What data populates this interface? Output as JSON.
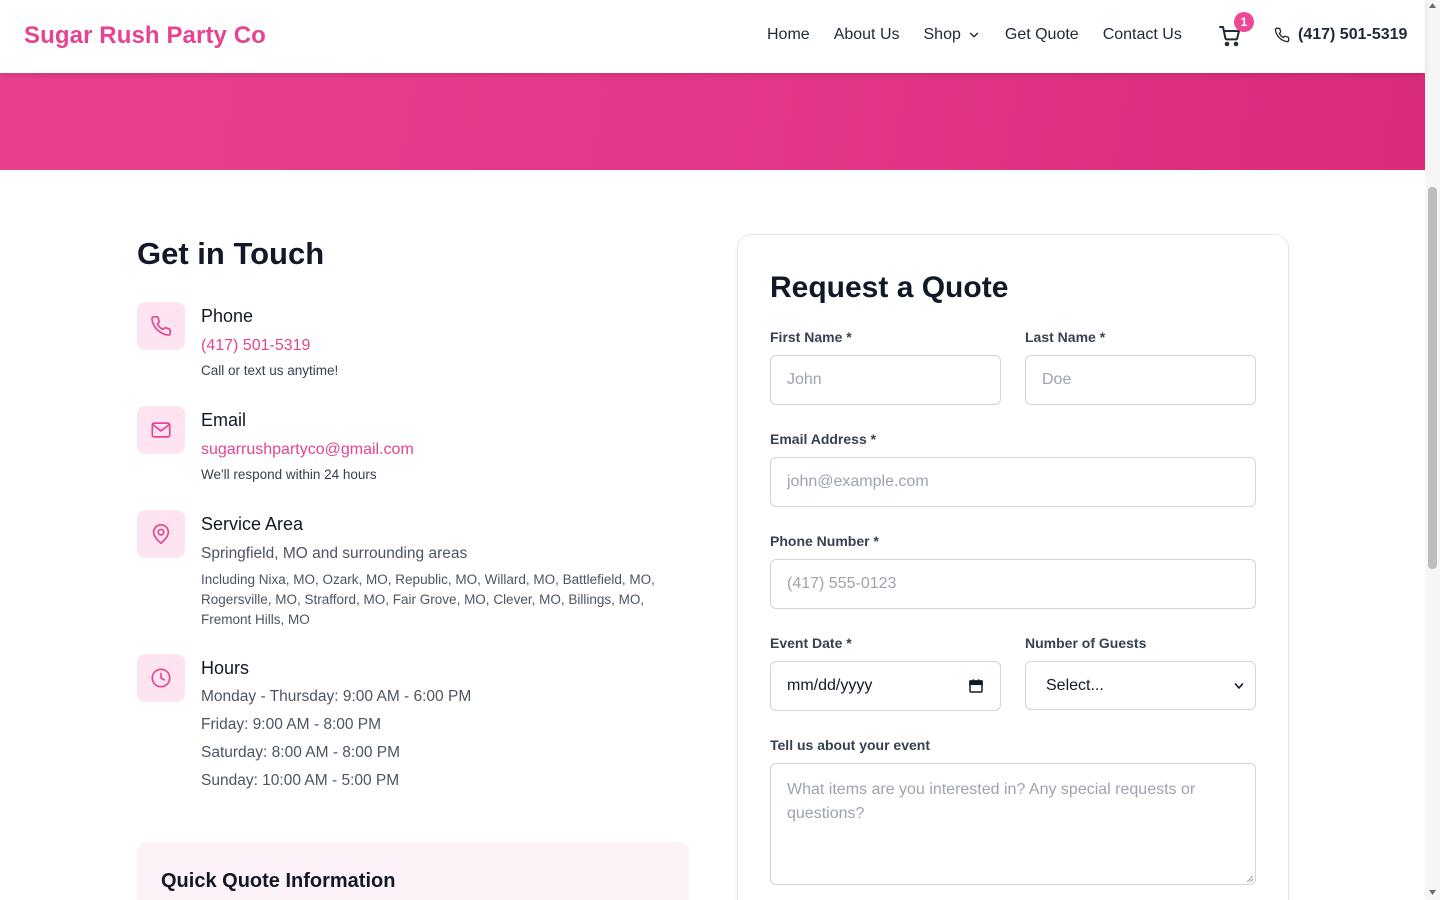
{
  "header": {
    "brand": "Sugar Rush Party Co",
    "nav": [
      "Home",
      "About Us",
      "Shop",
      "Get Quote",
      "Contact Us"
    ],
    "cart_count": "1",
    "phone": "(417) 501-5319"
  },
  "contact": {
    "title": "Get in Touch",
    "phone": {
      "title": "Phone",
      "value": "(417) 501-5319",
      "sub": "Call or text us anytime!"
    },
    "email": {
      "title": "Email",
      "value": "sugarrushpartyco@gmail.com",
      "sub": "We'll respond within 24 hours"
    },
    "area": {
      "title": "Service Area",
      "value": "Springfield, MO and surrounding areas",
      "detail": "Including Nixa, MO, Ozark, MO, Republic, MO, Willard, MO, Battlefield, MO, Rogersville, MO, Strafford, MO, Fair Grove, MO, Clever, MO, Billings, MO, Fremont Hills, MO"
    },
    "hours": {
      "title": "Hours",
      "lines": [
        "Monday - Thursday: 9:00 AM - 6:00 PM",
        "Friday: 9:00 AM - 8:00 PM",
        "Saturday: 8:00 AM - 8:00 PM",
        "Sunday: 10:00 AM - 5:00 PM"
      ]
    },
    "quick_quote_title": "Quick Quote Information"
  },
  "form": {
    "title": "Request a Quote",
    "first_name": {
      "label": "First Name *",
      "placeholder": "John"
    },
    "last_name": {
      "label": "Last Name *",
      "placeholder": "Doe"
    },
    "email": {
      "label": "Email Address *",
      "placeholder": "john@example.com"
    },
    "phone": {
      "label": "Phone Number *",
      "placeholder": "(417) 555-0123"
    },
    "event_date": {
      "label": "Event Date *",
      "value": "mm/dd/yyyy"
    },
    "guests": {
      "label": "Number of Guests",
      "value": "Select..."
    },
    "event": {
      "label": "Tell us about your event",
      "placeholder": "What items are you interested in? Any special requests or questions?"
    }
  },
  "colors": {
    "brand": "#e64492",
    "hero": "#e4388a",
    "icon_bg": "#fde4f0"
  }
}
